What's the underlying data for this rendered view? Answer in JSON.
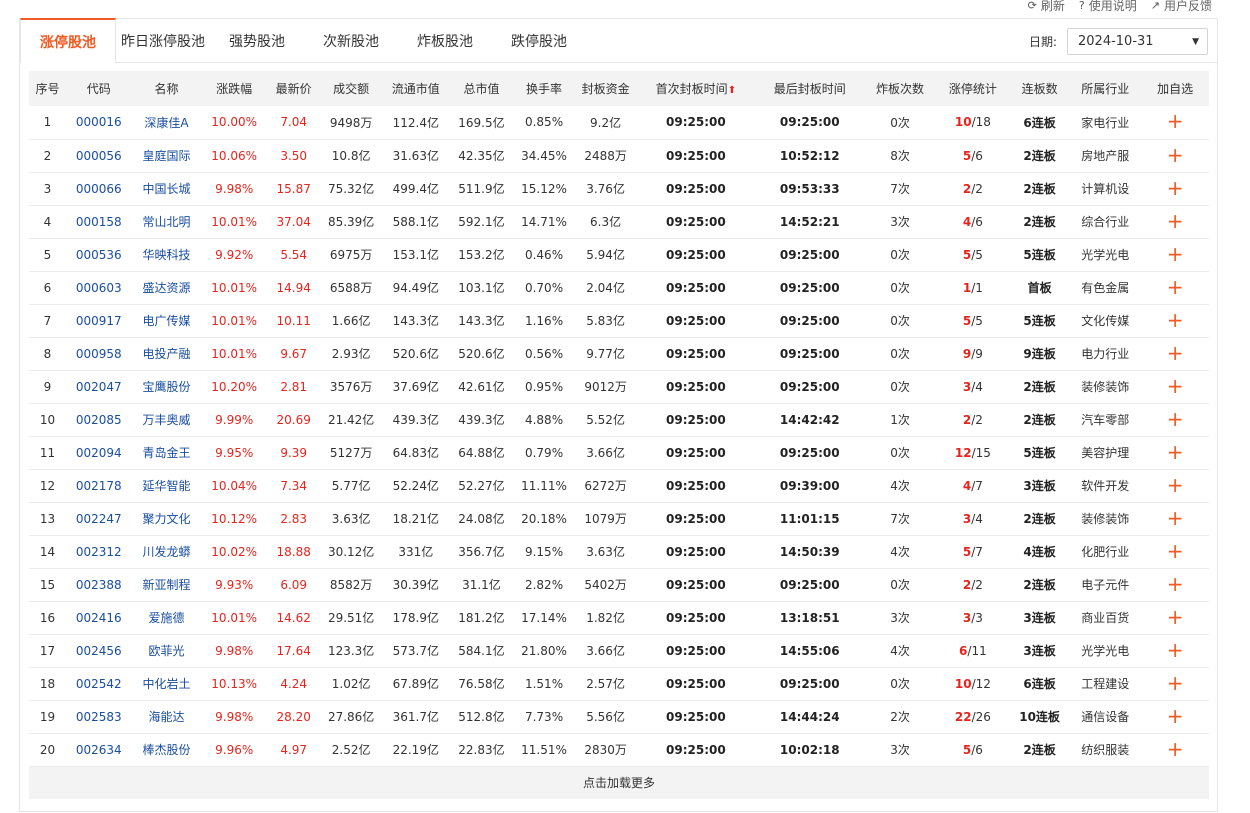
{
  "top_links": [
    {
      "icon": "refresh-icon",
      "glyph": "⟳",
      "label": "刷新"
    },
    {
      "icon": "help-icon",
      "glyph": "?",
      "label": "使用说明"
    },
    {
      "icon": "feedback-icon",
      "glyph": "↗",
      "label": "用户反馈"
    }
  ],
  "tabs": [
    "涨停股池",
    "昨日涨停股池",
    "强势股池",
    "次新股池",
    "炸板股池",
    "跌停股池"
  ],
  "active_tab": 0,
  "date": {
    "label": "日期:",
    "value": "2024-10-31"
  },
  "columns": [
    "序号",
    "代码",
    "名称",
    "涨跌幅",
    "最新价",
    "成交额",
    "流通市值",
    "总市值",
    "换手率",
    "封板资金",
    "首次封板时间",
    "最后封板时间",
    "炸板次数",
    "涨停统计",
    "连板数",
    "所属行业",
    "加自选"
  ],
  "sort_marker": "⬆",
  "rows": [
    {
      "no": "1",
      "code": "000016",
      "name": "深康佳A",
      "change": "10.00%",
      "price": "7.04",
      "turnover": "9498万",
      "float_cap": "112.4亿",
      "total_cap": "169.5亿",
      "turnover_rate": "0.85%",
      "seal_fund": "9.2亿",
      "first_seal": "09:25:00",
      "last_seal": "09:25:00",
      "breaks": "0次",
      "stat_hit": "10",
      "stat_total": "/18",
      "streak": "6连板",
      "industry": "家电行业"
    },
    {
      "no": "2",
      "code": "000056",
      "name": "皇庭国际",
      "change": "10.06%",
      "price": "3.50",
      "turnover": "10.8亿",
      "float_cap": "31.63亿",
      "total_cap": "42.35亿",
      "turnover_rate": "34.45%",
      "seal_fund": "2488万",
      "first_seal": "09:25:00",
      "last_seal": "10:52:12",
      "breaks": "8次",
      "stat_hit": "5",
      "stat_total": "/6",
      "streak": "2连板",
      "industry": "房地产服"
    },
    {
      "no": "3",
      "code": "000066",
      "name": "中国长城",
      "change": "9.98%",
      "price": "15.87",
      "turnover": "75.32亿",
      "float_cap": "499.4亿",
      "total_cap": "511.9亿",
      "turnover_rate": "15.12%",
      "seal_fund": "3.76亿",
      "first_seal": "09:25:00",
      "last_seal": "09:53:33",
      "breaks": "7次",
      "stat_hit": "2",
      "stat_total": "/2",
      "streak": "2连板",
      "industry": "计算机设"
    },
    {
      "no": "4",
      "code": "000158",
      "name": "常山北明",
      "change": "10.01%",
      "price": "37.04",
      "turnover": "85.39亿",
      "float_cap": "588.1亿",
      "total_cap": "592.1亿",
      "turnover_rate": "14.71%",
      "seal_fund": "6.3亿",
      "first_seal": "09:25:00",
      "last_seal": "14:52:21",
      "breaks": "3次",
      "stat_hit": "4",
      "stat_total": "/6",
      "streak": "2连板",
      "industry": "综合行业"
    },
    {
      "no": "5",
      "code": "000536",
      "name": "华映科技",
      "change": "9.92%",
      "price": "5.54",
      "turnover": "6975万",
      "float_cap": "153.1亿",
      "total_cap": "153.2亿",
      "turnover_rate": "0.46%",
      "seal_fund": "5.94亿",
      "first_seal": "09:25:00",
      "last_seal": "09:25:00",
      "breaks": "0次",
      "stat_hit": "5",
      "stat_total": "/5",
      "streak": "5连板",
      "industry": "光学光电"
    },
    {
      "no": "6",
      "code": "000603",
      "name": "盛达资源",
      "change": "10.01%",
      "price": "14.94",
      "turnover": "6588万",
      "float_cap": "94.49亿",
      "total_cap": "103.1亿",
      "turnover_rate": "0.70%",
      "seal_fund": "2.04亿",
      "first_seal": "09:25:00",
      "last_seal": "09:25:00",
      "breaks": "0次",
      "stat_hit": "1",
      "stat_total": "/1",
      "streak": "首板",
      "industry": "有色金属"
    },
    {
      "no": "7",
      "code": "000917",
      "name": "电广传媒",
      "change": "10.01%",
      "price": "10.11",
      "turnover": "1.66亿",
      "float_cap": "143.3亿",
      "total_cap": "143.3亿",
      "turnover_rate": "1.16%",
      "seal_fund": "5.83亿",
      "first_seal": "09:25:00",
      "last_seal": "09:25:00",
      "breaks": "0次",
      "stat_hit": "5",
      "stat_total": "/5",
      "streak": "5连板",
      "industry": "文化传媒"
    },
    {
      "no": "8",
      "code": "000958",
      "name": "电投产融",
      "change": "10.01%",
      "price": "9.67",
      "turnover": "2.93亿",
      "float_cap": "520.6亿",
      "total_cap": "520.6亿",
      "turnover_rate": "0.56%",
      "seal_fund": "9.77亿",
      "first_seal": "09:25:00",
      "last_seal": "09:25:00",
      "breaks": "0次",
      "stat_hit": "9",
      "stat_total": "/9",
      "streak": "9连板",
      "industry": "电力行业"
    },
    {
      "no": "9",
      "code": "002047",
      "name": "宝鹰股份",
      "change": "10.20%",
      "price": "2.81",
      "turnover": "3576万",
      "float_cap": "37.69亿",
      "total_cap": "42.61亿",
      "turnover_rate": "0.95%",
      "seal_fund": "9012万",
      "first_seal": "09:25:00",
      "last_seal": "09:25:00",
      "breaks": "0次",
      "stat_hit": "3",
      "stat_total": "/4",
      "streak": "2连板",
      "industry": "装修装饰"
    },
    {
      "no": "10",
      "code": "002085",
      "name": "万丰奥威",
      "change": "9.99%",
      "price": "20.69",
      "turnover": "21.42亿",
      "float_cap": "439.3亿",
      "total_cap": "439.3亿",
      "turnover_rate": "4.88%",
      "seal_fund": "5.52亿",
      "first_seal": "09:25:00",
      "last_seal": "14:42:42",
      "breaks": "1次",
      "stat_hit": "2",
      "stat_total": "/2",
      "streak": "2连板",
      "industry": "汽车零部"
    },
    {
      "no": "11",
      "code": "002094",
      "name": "青岛金王",
      "change": "9.95%",
      "price": "9.39",
      "turnover": "5127万",
      "float_cap": "64.83亿",
      "total_cap": "64.88亿",
      "turnover_rate": "0.79%",
      "seal_fund": "3.66亿",
      "first_seal": "09:25:00",
      "last_seal": "09:25:00",
      "breaks": "0次",
      "stat_hit": "12",
      "stat_total": "/15",
      "streak": "5连板",
      "industry": "美容护理"
    },
    {
      "no": "12",
      "code": "002178",
      "name": "延华智能",
      "change": "10.04%",
      "price": "7.34",
      "turnover": "5.77亿",
      "float_cap": "52.24亿",
      "total_cap": "52.27亿",
      "turnover_rate": "11.11%",
      "seal_fund": "6272万",
      "first_seal": "09:25:00",
      "last_seal": "09:39:00",
      "breaks": "4次",
      "stat_hit": "4",
      "stat_total": "/7",
      "streak": "3连板",
      "industry": "软件开发"
    },
    {
      "no": "13",
      "code": "002247",
      "name": "聚力文化",
      "change": "10.12%",
      "price": "2.83",
      "turnover": "3.63亿",
      "float_cap": "18.21亿",
      "total_cap": "24.08亿",
      "turnover_rate": "20.18%",
      "seal_fund": "1079万",
      "first_seal": "09:25:00",
      "last_seal": "11:01:15",
      "breaks": "7次",
      "stat_hit": "3",
      "stat_total": "/4",
      "streak": "2连板",
      "industry": "装修装饰"
    },
    {
      "no": "14",
      "code": "002312",
      "name": "川发龙蟒",
      "change": "10.02%",
      "price": "18.88",
      "turnover": "30.12亿",
      "float_cap": "331亿",
      "total_cap": "356.7亿",
      "turnover_rate": "9.15%",
      "seal_fund": "3.63亿",
      "first_seal": "09:25:00",
      "last_seal": "14:50:39",
      "breaks": "4次",
      "stat_hit": "5",
      "stat_total": "/7",
      "streak": "4连板",
      "industry": "化肥行业"
    },
    {
      "no": "15",
      "code": "002388",
      "name": "新亚制程",
      "change": "9.93%",
      "price": "6.09",
      "turnover": "8582万",
      "float_cap": "30.39亿",
      "total_cap": "31.1亿",
      "turnover_rate": "2.82%",
      "seal_fund": "5402万",
      "first_seal": "09:25:00",
      "last_seal": "09:25:00",
      "breaks": "0次",
      "stat_hit": "2",
      "stat_total": "/2",
      "streak": "2连板",
      "industry": "电子元件"
    },
    {
      "no": "16",
      "code": "002416",
      "name": "爱施德",
      "change": "10.01%",
      "price": "14.62",
      "turnover": "29.51亿",
      "float_cap": "178.9亿",
      "total_cap": "181.2亿",
      "turnover_rate": "17.14%",
      "seal_fund": "1.82亿",
      "first_seal": "09:25:00",
      "last_seal": "13:18:51",
      "breaks": "3次",
      "stat_hit": "3",
      "stat_total": "/3",
      "streak": "3连板",
      "industry": "商业百货"
    },
    {
      "no": "17",
      "code": "002456",
      "name": "欧菲光",
      "change": "9.98%",
      "price": "17.64",
      "turnover": "123.3亿",
      "float_cap": "573.7亿",
      "total_cap": "584.1亿",
      "turnover_rate": "21.80%",
      "seal_fund": "3.66亿",
      "first_seal": "09:25:00",
      "last_seal": "14:55:06",
      "breaks": "4次",
      "stat_hit": "6",
      "stat_total": "/11",
      "streak": "3连板",
      "industry": "光学光电"
    },
    {
      "no": "18",
      "code": "002542",
      "name": "中化岩土",
      "change": "10.13%",
      "price": "4.24",
      "turnover": "1.02亿",
      "float_cap": "67.89亿",
      "total_cap": "76.58亿",
      "turnover_rate": "1.51%",
      "seal_fund": "2.57亿",
      "first_seal": "09:25:00",
      "last_seal": "09:25:00",
      "breaks": "0次",
      "stat_hit": "10",
      "stat_total": "/12",
      "streak": "6连板",
      "industry": "工程建设"
    },
    {
      "no": "19",
      "code": "002583",
      "name": "海能达",
      "change": "9.98%",
      "price": "28.20",
      "turnover": "27.86亿",
      "float_cap": "361.7亿",
      "total_cap": "512.8亿",
      "turnover_rate": "7.73%",
      "seal_fund": "5.56亿",
      "first_seal": "09:25:00",
      "last_seal": "14:44:24",
      "breaks": "2次",
      "stat_hit": "22",
      "stat_total": "/26",
      "streak": "10连板",
      "industry": "通信设备"
    },
    {
      "no": "20",
      "code": "002634",
      "name": "棒杰股份",
      "change": "9.96%",
      "price": "4.97",
      "turnover": "2.52亿",
      "float_cap": "22.19亿",
      "total_cap": "22.83亿",
      "turnover_rate": "11.51%",
      "seal_fund": "2830万",
      "first_seal": "09:25:00",
      "last_seal": "10:02:18",
      "breaks": "3次",
      "stat_hit": "5",
      "stat_total": "/6",
      "streak": "2连板",
      "industry": "纺织服装"
    }
  ],
  "add_glyph": "+",
  "load_more": "点击加载更多",
  "colors": {
    "accent": "#f15a22",
    "up": "#e6241d",
    "link": "#1a4ea2"
  }
}
